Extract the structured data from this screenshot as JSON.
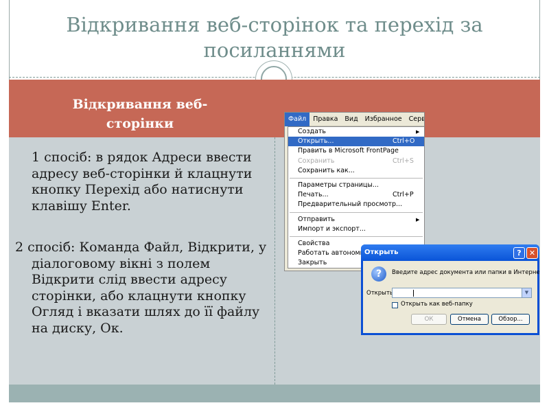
{
  "slide": {
    "title": "Відкривання веб-сторінок та перехід за посиланнями",
    "section_title": "Відкривання веб-сторінки",
    "method1": "1 спосіб: в рядок Адреси ввести адресу веб-сторінки й клацнути кнопку Перехід або натиснути клавішу Enter.",
    "method2": "2 спосіб: Команда Файл, Відкрити, у діалоговому вікні з полем Відкрити слід ввести адресу сторінки, або клацнути кнопку Огляд і вказати шлях до її файлу на диску, Ок."
  },
  "menubar": {
    "file": "Файл",
    "edit": "Правка",
    "view": "Вид",
    "favorites": "Избранное",
    "service": "Сервис"
  },
  "file_menu": {
    "items": [
      {
        "label": "Создать",
        "shortcut": "",
        "submenu": true
      },
      {
        "label": "Открыть...",
        "shortcut": "Ctrl+O"
      },
      {
        "label": "Править в Microsoft FrontPage",
        "shortcut": ""
      },
      {
        "label": "Сохранить",
        "shortcut": "Ctrl+S"
      },
      {
        "label": "Сохранить как...",
        "shortcut": ""
      },
      {
        "label": "Параметры страницы...",
        "shortcut": ""
      },
      {
        "label": "Печать...",
        "shortcut": "Ctrl+P"
      },
      {
        "label": "Предварительный просмотр...",
        "shortcut": ""
      },
      {
        "label": "Отправить",
        "shortcut": "",
        "submenu": true
      },
      {
        "label": "Импорт и экспорт...",
        "shortcut": ""
      },
      {
        "label": "Свойства",
        "shortcut": ""
      },
      {
        "label": "Работать автономно",
        "shortcut": ""
      },
      {
        "label": "Закрыть",
        "shortcut": ""
      }
    ],
    "submenu_arrow": "▶"
  },
  "dialog": {
    "title": "Открыть",
    "help": "?",
    "close": "✕",
    "question_mark": "?",
    "message": "Введите адрес документа или папки в Интернете.",
    "field_label": "Открыть:",
    "field_value": "",
    "dropdown_arrow": "▼",
    "checkbox_label": "Открыть как веб-папку",
    "checkbox_checked": false,
    "ok_label": "ОК",
    "cancel_label": "Отмена",
    "browse_label": "Обзор..."
  },
  "colors": {
    "title": "#6f8d8b",
    "band": "#c66856",
    "content_bg": "#c9d1d4",
    "footer": "#9bb2b2",
    "selection": "#316ac5",
    "dialog_frame": "#0a4fd4"
  }
}
